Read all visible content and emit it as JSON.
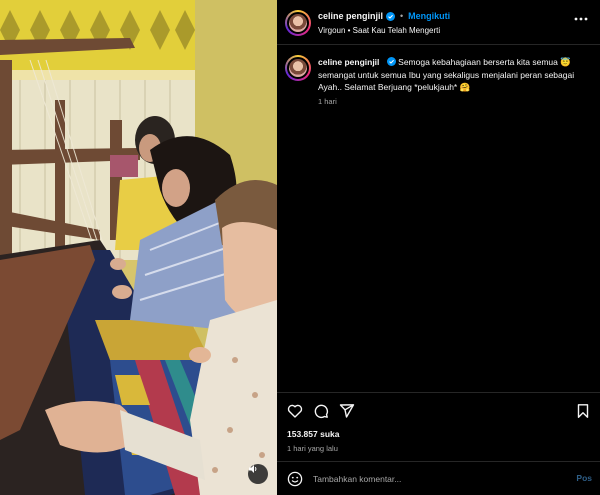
{
  "post": {
    "username": "celine penginjil",
    "follow_label": "Mengikuti",
    "audio_line": "Virgoun • Saat Kau Telah Mengerti",
    "caption_text": "Semoga kebahagiaan berserta kita semua 😇 semangat untuk semua Ibu yang sekaligus menjalani peran sebagai Ayah.. Selamat Berjuang *pelukjauh* 🤗",
    "caption_time": "1 hari",
    "likes": "153.857 suka",
    "time_ago": "1 hari yang lalu"
  },
  "comment": {
    "placeholder": "Tambahkan komentar...",
    "post_label": "Pos"
  },
  "icons": {
    "like": "heart-icon",
    "comment": "comment-icon",
    "share": "paper-plane-icon",
    "save": "bookmark-icon",
    "emoji": "smiley-icon",
    "more": "more-dots-icon",
    "audio": "speaker-icon",
    "verified": "verified-badge-icon"
  },
  "colors": {
    "accent": "#0095f6",
    "background": "#000000",
    "divider": "#262626",
    "muted_text": "#a8a8a8"
  }
}
